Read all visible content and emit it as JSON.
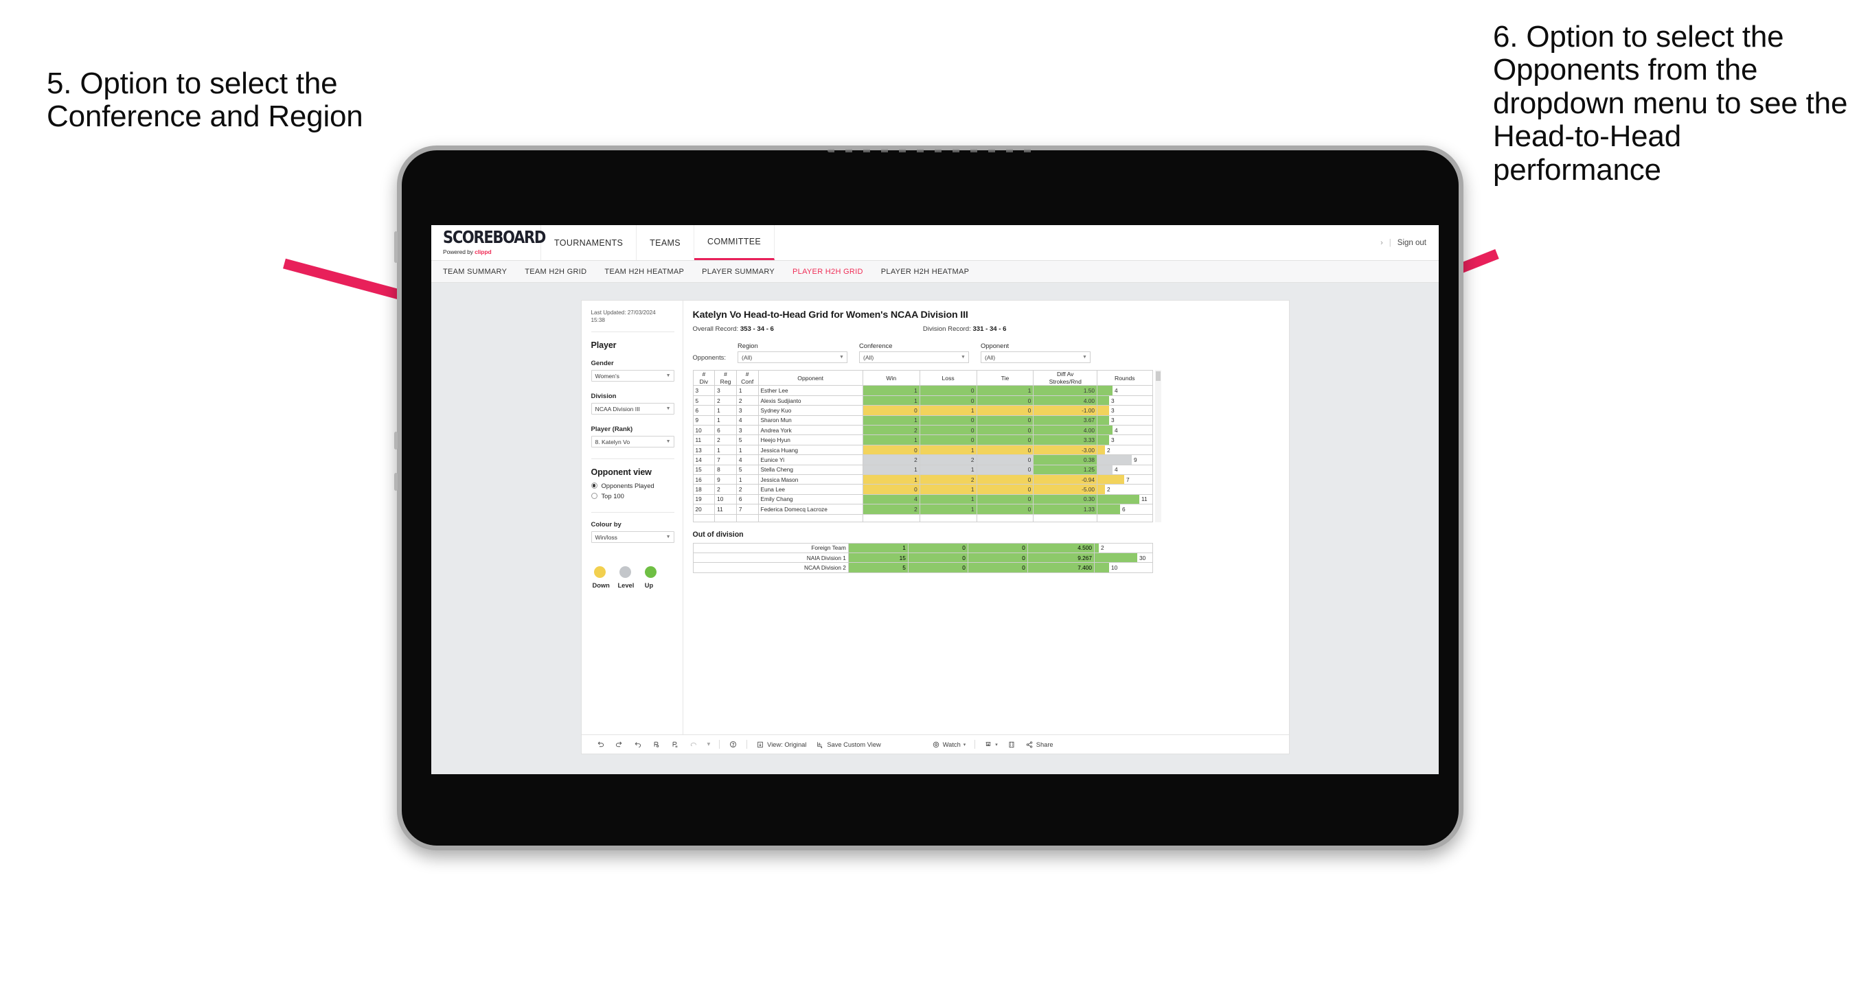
{
  "annotations": {
    "left": "5. Option to select the Conference and Region",
    "right": "6. Option to select the Opponents from the dropdown menu to see the Head-to-Head performance",
    "arrow_color": "#e8205a"
  },
  "topnav": {
    "logo_word": "SCOREBOARD",
    "logo_powered_prefix": "Powered by ",
    "logo_brand": "clippd",
    "items": [
      {
        "label": "TOURNAMENTS",
        "active": false
      },
      {
        "label": "TEAMS",
        "active": false
      },
      {
        "label": "COMMITTEE",
        "active": true
      }
    ],
    "chevron": "›",
    "divider": "|",
    "signout": "Sign out"
  },
  "subnav": {
    "items": [
      {
        "label": "TEAM SUMMARY",
        "active": false
      },
      {
        "label": "TEAM H2H GRID",
        "active": false
      },
      {
        "label": "TEAM H2H HEATMAP",
        "active": false
      },
      {
        "label": "PLAYER SUMMARY",
        "active": false
      },
      {
        "label": "PLAYER H2H GRID",
        "active": true
      },
      {
        "label": "PLAYER H2H HEATMAP",
        "active": false
      }
    ],
    "active_color": "#ef2d56"
  },
  "sidebar": {
    "last_updated": "Last Updated: 27/03/2024",
    "last_updated_time": "15:38",
    "section_title": "Player",
    "fields": [
      {
        "label": "Gender",
        "value": "Women's"
      },
      {
        "label": "Division",
        "value": "NCAA Division III"
      },
      {
        "label": "Player (Rank)",
        "value": "8. Katelyn Vo"
      }
    ],
    "opponent_view": {
      "title": "Opponent view",
      "options": [
        {
          "label": "Opponents Played",
          "selected": true
        },
        {
          "label": "Top 100",
          "selected": false
        }
      ]
    },
    "colour_by": {
      "label": "Colour by",
      "value": "Win/loss"
    },
    "legend": [
      {
        "label": "Down",
        "color": "#f2d04f"
      },
      {
        "label": "Level",
        "color": "#c3c6ca"
      },
      {
        "label": "Up",
        "color": "#6fbf44"
      }
    ]
  },
  "main": {
    "title": "Katelyn Vo Head-to-Head Grid for Women's NCAA Division III",
    "overall_record_label": "Overall Record:",
    "overall_record_value": "353 - 34 - 6",
    "division_record_label": "Division Record:",
    "division_record_value": "331 -  34 - 6",
    "opponents_label": "Opponents:",
    "filters": [
      {
        "label": "Region",
        "value": "(All)"
      },
      {
        "label": "Conference",
        "value": "(All)"
      },
      {
        "label": "Opponent",
        "value": "(All)"
      }
    ]
  },
  "chart_data": {
    "type": "table",
    "title": "Katelyn Vo Head-to-Head Grid for Women's NCAA Division III",
    "columns": [
      "# Div",
      "# Reg",
      "# Conf",
      "Opponent",
      "Win",
      "Loss",
      "Tie",
      "Diff Av Strokes/Rnd",
      "Rounds"
    ],
    "column_headers_stacked": [
      {
        "l1": "#",
        "l2": "Div"
      },
      {
        "l1": "#",
        "l2": "Reg"
      },
      {
        "l1": "#",
        "l2": "Conf"
      },
      {
        "l1": "Opponent",
        "l2": ""
      },
      {
        "l1": "Win",
        "l2": ""
      },
      {
        "l1": "Loss",
        "l2": ""
      },
      {
        "l1": "Tie",
        "l2": ""
      },
      {
        "l1": "Diff Av",
        "l2": "Strokes/Rnd"
      },
      {
        "l1": "Rounds",
        "l2": ""
      }
    ],
    "rounds_max": 12,
    "colors": {
      "up": "#8dc96a",
      "down": "#f2d35c",
      "level": "#d2d4d6"
    },
    "rows": [
      {
        "div": "3",
        "reg": "3",
        "conf": "1",
        "opponent": "Esther Lee",
        "win": "1",
        "loss": "0",
        "tie": "1",
        "diff": "1.50",
        "rounds": 4,
        "state": "up"
      },
      {
        "div": "5",
        "reg": "2",
        "conf": "2",
        "opponent": "Alexis Sudjianto",
        "win": "1",
        "loss": "0",
        "tie": "0",
        "diff": "4.00",
        "rounds": 3,
        "state": "up"
      },
      {
        "div": "6",
        "reg": "1",
        "conf": "3",
        "opponent": "Sydney Kuo",
        "win": "0",
        "loss": "1",
        "tie": "0",
        "diff": "-1.00",
        "rounds": 3,
        "state": "down"
      },
      {
        "div": "9",
        "reg": "1",
        "conf": "4",
        "opponent": "Sharon Mun",
        "win": "1",
        "loss": "0",
        "tie": "0",
        "diff": "3.67",
        "rounds": 3,
        "state": "up"
      },
      {
        "div": "10",
        "reg": "6",
        "conf": "3",
        "opponent": "Andrea York",
        "win": "2",
        "loss": "0",
        "tie": "0",
        "diff": "4.00",
        "rounds": 4,
        "state": "up"
      },
      {
        "div": "11",
        "reg": "2",
        "conf": "5",
        "opponent": "Heejo Hyun",
        "win": "1",
        "loss": "0",
        "tie": "0",
        "diff": "3.33",
        "rounds": 3,
        "state": "up"
      },
      {
        "div": "13",
        "reg": "1",
        "conf": "1",
        "opponent": "Jessica Huang",
        "win": "0",
        "loss": "1",
        "tie": "0",
        "diff": "-3.00",
        "rounds": 2,
        "state": "down"
      },
      {
        "div": "14",
        "reg": "7",
        "conf": "4",
        "opponent": "Eunice Yi",
        "win": "2",
        "loss": "2",
        "tie": "0",
        "diff": "0.38",
        "rounds": 9,
        "state": "level",
        "diff_state": "up"
      },
      {
        "div": "15",
        "reg": "8",
        "conf": "5",
        "opponent": "Stella Cheng",
        "win": "1",
        "loss": "1",
        "tie": "0",
        "diff": "1.25",
        "rounds": 4,
        "state": "level",
        "diff_state": "up"
      },
      {
        "div": "16",
        "reg": "9",
        "conf": "1",
        "opponent": "Jessica Mason",
        "win": "1",
        "loss": "2",
        "tie": "0",
        "diff": "-0.94",
        "rounds": 7,
        "state": "down"
      },
      {
        "div": "18",
        "reg": "2",
        "conf": "2",
        "opponent": "Euna Lee",
        "win": "0",
        "loss": "1",
        "tie": "0",
        "diff": "-5.00",
        "rounds": 2,
        "state": "down"
      },
      {
        "div": "19",
        "reg": "10",
        "conf": "6",
        "opponent": "Emily Chang",
        "win": "4",
        "loss": "1",
        "tie": "0",
        "diff": "0.30",
        "rounds": 11,
        "state": "up"
      },
      {
        "div": "20",
        "reg": "11",
        "conf": "7",
        "opponent": "Federica Domecq Lacroze",
        "win": "2",
        "loss": "1",
        "tie": "0",
        "diff": "1.33",
        "rounds": 6,
        "state": "up"
      }
    ],
    "out_of_division": {
      "title": "Out of division",
      "rounds_max": 32,
      "rows": [
        {
          "name": "Foreign Team",
          "win": "1",
          "loss": "0",
          "tie": "0",
          "diff": "4.500",
          "rounds": 2,
          "state": "up"
        },
        {
          "name": "NAIA Division 1",
          "win": "15",
          "loss": "0",
          "tie": "0",
          "diff": "9.267",
          "rounds": 30,
          "state": "up"
        },
        {
          "name": "NCAA Division 2",
          "win": "5",
          "loss": "0",
          "tie": "0",
          "diff": "7.400",
          "rounds": 10,
          "state": "up"
        }
      ]
    }
  },
  "toolbar": {
    "items": [
      {
        "name": "undo-icon",
        "label": ""
      },
      {
        "name": "redo-icon",
        "label": ""
      },
      {
        "name": "revert-icon",
        "label": ""
      },
      {
        "name": "refresh-data-icon",
        "label": ""
      },
      {
        "name": "pause-updates-icon",
        "label": ""
      },
      {
        "name": "highlight-icon",
        "label": ""
      },
      {
        "name": "caret-down-icon",
        "label": ""
      },
      {
        "name": "help-icon",
        "label": ""
      },
      {
        "name": "view-original-icon",
        "label": "View: Original"
      },
      {
        "name": "save-custom-view-icon",
        "label": "Save Custom View"
      },
      {
        "name": "watch-icon",
        "label": "Watch"
      },
      {
        "name": "watch-caret-icon",
        "label": ""
      },
      {
        "name": "download-icon",
        "label": ""
      },
      {
        "name": "download-caret-icon",
        "label": ""
      },
      {
        "name": "fullscreen-icon",
        "label": ""
      },
      {
        "name": "share-icon",
        "label": "Share"
      }
    ],
    "view_original": "View: Original",
    "save_custom_view": "Save Custom View",
    "watch": "Watch",
    "share": "Share",
    "caret": "▾"
  }
}
